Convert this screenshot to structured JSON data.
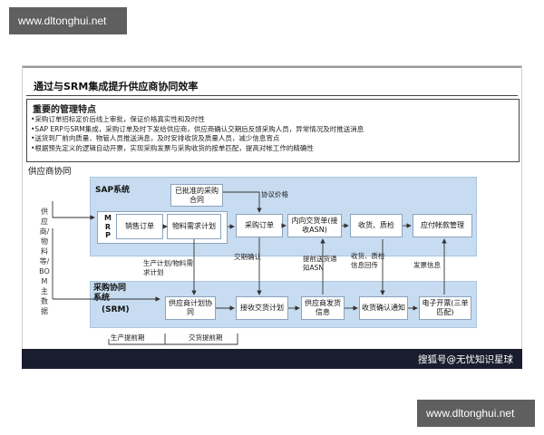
{
  "watermark": {
    "top": "www.dltonghui.net",
    "bottom": "www.dltonghui.net"
  },
  "slide": {
    "title": "通过与SRM集成提升供应商协同效率",
    "features_heading": "重要的管理特点",
    "features": [
      "•采购订单招标定价后线上审批，保证价格真实性和及时性",
      "•SAP ERP与SRM集成，采购订单及时下发给供应商，供应商确认交期后反馈采购人员，异常情况及时推送消息",
      "•送货到厂前向质量、物管人员推送消息，及时安排收货及质量人员，减少信息宵点",
      "•根据预先定义的逻辑自动开票，实现采购发票与采购收货的按单匹配，提高对帐工作的精确性"
    ],
    "section_title": "供应商协同",
    "vertical_label": "供应商/物料等/BOM主数据"
  },
  "diagram": {
    "sap_title": "SAP系统",
    "srm_title_line1": "采购协同",
    "srm_title_line2": "系统",
    "srm_code": "(SRM)",
    "mrp_label": "MRP",
    "sap_boxes": {
      "approved_contract": "已批准的采购合同",
      "sales_order": "销售订单",
      "material_plan": "物料需求计划",
      "purchase_order": "采购订单",
      "inbound_delivery": "内向交货单(接收ASN)",
      "receipt_qc": "收货、质检",
      "ap_invoice": "应付帐款管理"
    },
    "srm_boxes": {
      "supplier_plan": "供应商计划协同",
      "accept_plan": "接收交货计划",
      "supplier_ship": "供应商发货信息",
      "receipt_notice": "收货确认通知",
      "e_invoice": "电子开票(三单匹配)"
    },
    "notes": {
      "agreed_price": "协议价格",
      "prod_material_plan": "生产计划/物料需求计划",
      "delivery_confirm": "交期确认",
      "advance_ship_asn": "提前送货通知ASN",
      "receipt_qc_feedback": "收货、质检信息回传",
      "invoice_info": "发票信息",
      "prod_lead": "生产提前期",
      "ship_lead": "交货提前期"
    }
  },
  "footer": {
    "text": "搜狐号@无忧知识星球"
  },
  "colors": {
    "band": "#c7dcf0",
    "footer": "#1a1d2e",
    "watermark": "#5f5f5f"
  }
}
